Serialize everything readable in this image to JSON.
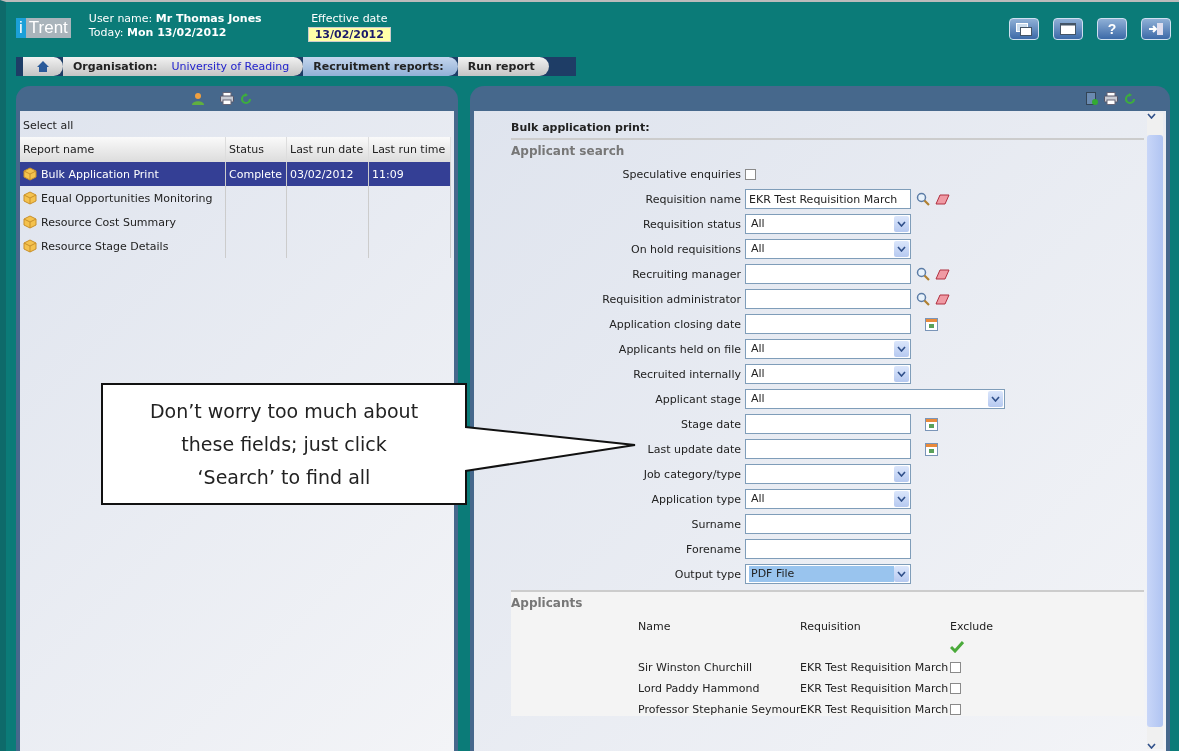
{
  "header": {
    "logo": {
      "prefix": "i",
      "name": "Trent"
    },
    "user_label": "User name:",
    "user_value": "Mr Thomas Jones",
    "today_label": "Today:",
    "today_value": "Mon 13/02/2012",
    "effective_label": "Effective date",
    "effective_value": "13/02/2012",
    "help": "?"
  },
  "breadcrumb": [
    {
      "kind": "home"
    },
    {
      "kind": "org",
      "label": "Organisation:",
      "value": "University of Reading"
    },
    {
      "kind": "step",
      "label": "Recruitment reports:",
      "selected": true
    },
    {
      "kind": "step",
      "label": "Run report",
      "selected": false
    }
  ],
  "reports": {
    "select_all": "Select all",
    "columns": [
      "Report name",
      "Status",
      "Last run date",
      "Last run time"
    ],
    "rows": [
      {
        "name": "Bulk Application Print",
        "status": "Complete",
        "date": "03/02/2012",
        "time": "11:09",
        "selected": true
      },
      {
        "name": "Equal Opportunities Monitoring",
        "selected": false
      },
      {
        "name": "Resource Cost Summary",
        "selected": false
      },
      {
        "name": "Resource Stage Details",
        "selected": false
      }
    ]
  },
  "form": {
    "title": "Bulk application print:",
    "section": "Applicant search",
    "fields": [
      {
        "kind": "checkbox",
        "label": "Speculative enquiries",
        "checked": false
      },
      {
        "kind": "lookup",
        "label": "Requisition name",
        "value": "EKR Test Requisition March"
      },
      {
        "kind": "select",
        "label": "Requisition status",
        "value": "All"
      },
      {
        "kind": "select",
        "label": "On hold requisitions",
        "value": "All"
      },
      {
        "kind": "lookup",
        "label": "Recruiting manager"
      },
      {
        "kind": "lookup",
        "label": "Requisition administrator"
      },
      {
        "kind": "date",
        "label": "Application closing date"
      },
      {
        "kind": "select",
        "label": "Applicants held on file",
        "value": "All"
      },
      {
        "kind": "select",
        "label": "Recruited internally",
        "value": "All"
      },
      {
        "kind": "wideselect",
        "label": "Applicant stage",
        "value": "All"
      },
      {
        "kind": "date",
        "label": "Stage date"
      },
      {
        "kind": "date",
        "label": "Last update date"
      },
      {
        "kind": "select",
        "label": "Job category/type"
      },
      {
        "kind": "select",
        "label": "Application type",
        "value": "All"
      },
      {
        "kind": "text",
        "label": "Surname"
      },
      {
        "kind": "text",
        "label": "Forename"
      },
      {
        "kind": "select",
        "label": "Output type",
        "value": "PDF File",
        "highlighted": true
      }
    ],
    "applicants_title": "Applicants",
    "applicant_columns": [
      "Name",
      "Requisition",
      "Exclude"
    ],
    "applicants": [
      {
        "name": "Sir Winston Churchill",
        "requisition": "EKR Test Requisition March",
        "excluded": false
      },
      {
        "name": "Lord Paddy Hammond",
        "requisition": "EKR Test Requisition March",
        "excluded": false
      },
      {
        "name": "Professor Stephanie Seymour",
        "requisition": "EKR Test Requisition March",
        "excluded": false
      }
    ]
  },
  "callout": {
    "text": "Don’t worry too much about these fields; just click ‘Search’ to find all"
  }
}
